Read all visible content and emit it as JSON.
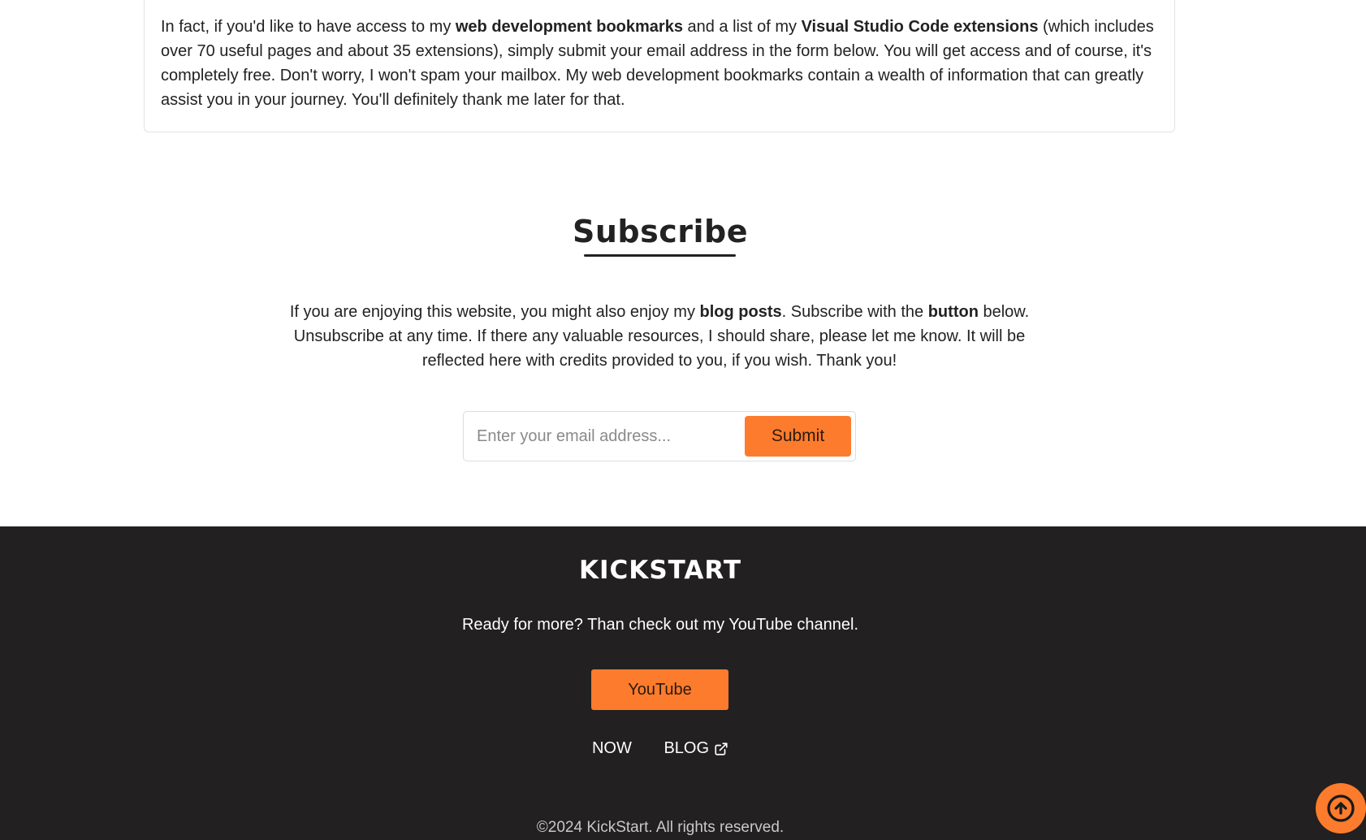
{
  "info": {
    "part1": "In fact, if you'd like to have access to my ",
    "bold1": "web development bookmarks",
    "part2": " and a list of my ",
    "bold2": "Visual Studio Code extensions",
    "part3": " (which includes over 70 useful pages and about 35 extensions), simply submit your email address in the form below. You will get access and of course, it's completely free. Don't worry, I won't spam your mailbox. My web development bookmarks contain a wealth of information that can greatly assist you in your journey. You'll definitely thank me later for that."
  },
  "subscribe": {
    "title": "Subscribe",
    "part1": "If you are enjoying this website, you might also enjoy my ",
    "bold1": "blog posts",
    "part2": ". Subscribe with the ",
    "bold2": "button",
    "part3": " below. Unsubscribe at any time. If there any valuable resources, I should share, please let me know. It will be reflected here with credits provided to you, if you wish. Thank you!",
    "email_value": "",
    "email_placeholder": "Enter your email address...",
    "submit_label": "Submit"
  },
  "footer": {
    "brand": "KICKSTART",
    "tagline": "Ready for more? Than check out my YouTube channel.",
    "youtube_label": "YouTube",
    "nav": [
      {
        "label": "NOW"
      },
      {
        "label": "BLOG",
        "icon": "external-link-icon"
      }
    ],
    "copyright": "©2024 KickStart. All rights reserved."
  },
  "scroll_top": {
    "icon": "arrow-up-circle-icon"
  },
  "colors": {
    "accent": "#fd7b2c",
    "footer_bg": "#222020",
    "text": "#222222"
  }
}
